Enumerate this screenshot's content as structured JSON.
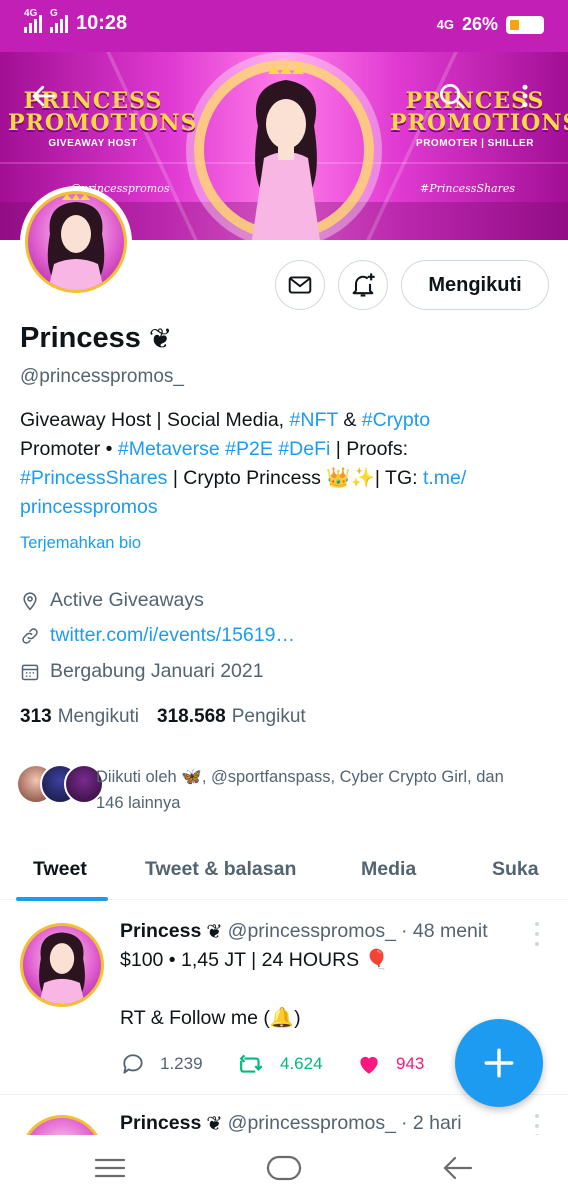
{
  "status_bar": {
    "network_1": "4G",
    "network_2": "G",
    "time": "10:28",
    "network_right": "4G",
    "battery_percent": "26%",
    "battery_level": 0.26
  },
  "banner": {
    "left_brand_title": "PRINCESS PROMOTIONS",
    "left_brand_subtitle": "GIVEAWAY HOST",
    "right_brand_title": "PRINCESS PROMOTIONS",
    "right_brand_subtitle": "PROMOTER | SHILLER",
    "left_tag": "@princesspromos",
    "right_tag": "#PrincessShares"
  },
  "profile": {
    "follow_label": "Mengikuti",
    "name": "Princess",
    "name_emoji": "❦",
    "handle": "@princesspromos_",
    "bio": {
      "line1_a": "Giveaway Host | Social Media, ",
      "line1_tag1": "#NFT",
      "line1_b": " & ",
      "line1_tag2": "#Crypto",
      "line2_a": "Promoter • ",
      "line2_tag1": "#Metaverse",
      "line2_tag2": "#P2E",
      "line2_tag3": "#DeFi",
      "line2_b": " | Proofs:",
      "line3_tag": "#PrincessShares",
      "line3_a": " | Crypto Princess 👑✨| TG: ",
      "line3_link": "t.me/",
      "line4_link": "princesspromos"
    },
    "translate_label": "Terjemahkan bio",
    "location": "Active Giveaways",
    "website": "twitter.com/i/events/15619…",
    "joined": "Bergabung Januari 2021",
    "following_count": "313",
    "following_label": "Mengikuti",
    "followers_count": "318.568",
    "followers_label": "Pengikut",
    "followed_by_prefix": "Diikuti oleh 🦋, @sportfanspass, Cyber Crypto Girl, dan",
    "followed_by_suffix": "146 lainnya"
  },
  "tabs": [
    "Tweet",
    "Tweet & balasan",
    "Media",
    "Suka"
  ],
  "tweets": [
    {
      "name": "Princess",
      "handle": "@princesspromos_",
      "time": "· 48 menit",
      "line1": "$100 • 1,45 JT | 24 HOURS 🎈",
      "line2": "RT & Follow me (🔔)",
      "replies": "1.239",
      "retweets": "4.624",
      "likes": "943"
    },
    {
      "name": "Princess",
      "handle": "@princesspromos_",
      "time": "· 2 hari"
    }
  ],
  "colors": {
    "status_bar": "#c21fb6",
    "accent": "#1d9bf0",
    "retweet_green": "#00ba7c",
    "like_pink": "#f91880",
    "battery": "#f5a21a"
  },
  "icons": {
    "back": "arrow-left-icon",
    "search": "search-icon",
    "more": "more-vertical-icon",
    "message": "mail-icon",
    "notify": "bell-plus-icon",
    "location": "location-pin-icon",
    "website": "link-icon",
    "joined": "calendar-icon",
    "reply": "reply-icon",
    "retweet": "retweet-icon",
    "like": "heart-icon",
    "compose": "plus-icon"
  }
}
